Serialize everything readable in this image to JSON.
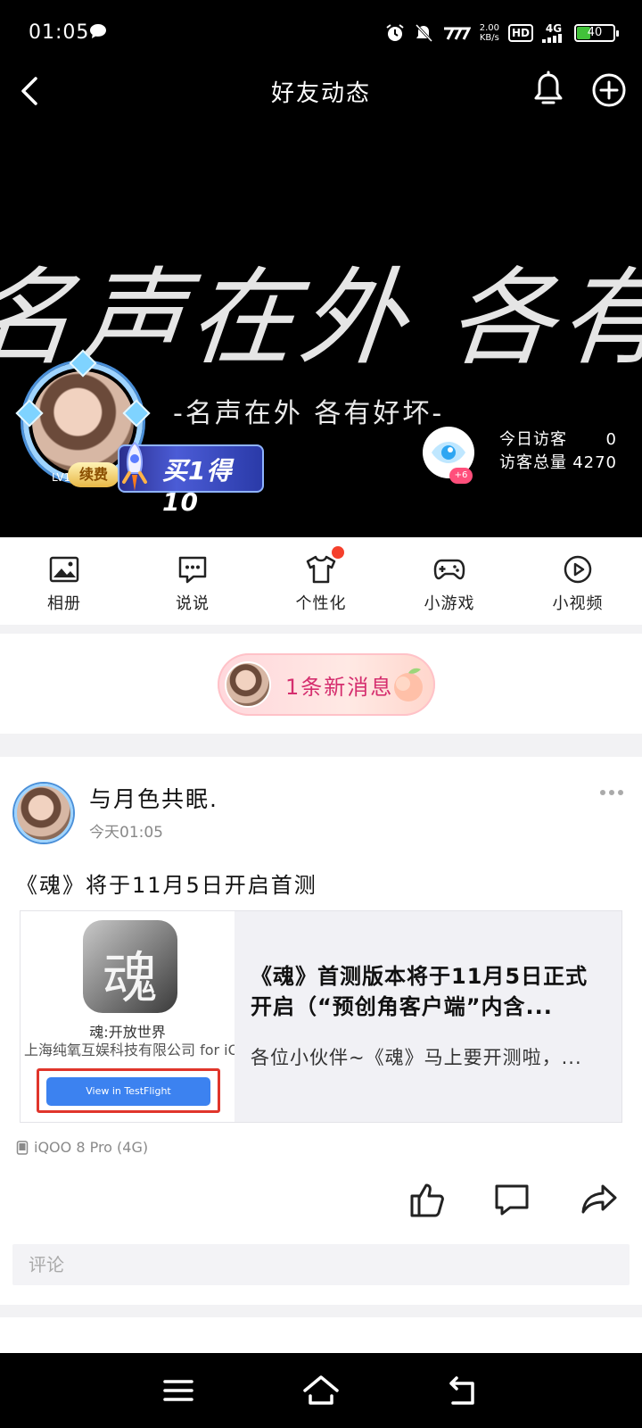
{
  "status_bar": {
    "time": "01:05",
    "net_speed_value": "2.00",
    "net_speed_unit": "KB/s",
    "hd_label": "HD",
    "network": "4G",
    "battery_level": 40,
    "battery_text": "40"
  },
  "header": {
    "title": "好友动态"
  },
  "banner": {
    "big_text": "名声在外 各有好坏",
    "sub_text": "-名声在外   各有好坏-",
    "level": "LV1",
    "renew_label": "续费",
    "promo_label": "买1得10",
    "visitor_badge": "+6",
    "today_visitors_label": "今日访客",
    "today_visitors_value": "0",
    "total_visitors_label": "访客总量",
    "total_visitors_value": "4270"
  },
  "quick_nav": {
    "items": [
      {
        "label": "相册",
        "icon": "photo-album-icon"
      },
      {
        "label": "说说",
        "icon": "speech-bubble-icon"
      },
      {
        "label": "个性化",
        "icon": "tshirt-icon",
        "has_dot": true
      },
      {
        "label": "小游戏",
        "icon": "gamepad-icon"
      },
      {
        "label": "小视频",
        "icon": "play-circle-icon"
      }
    ]
  },
  "new_message": {
    "label": "1条新消息"
  },
  "post": {
    "author": "与月色共眠.",
    "time": "今天01:05",
    "text": "《魂》将于11月5日开启首测",
    "share": {
      "thumb_icon_char": "魂",
      "thumb_title": "魂:开放世界",
      "thumb_company": "上海纯氧互娱科技有限公司 for iOS",
      "thumb_button": "View in TestFlight",
      "title": "《魂》首测版本将于11月5日正式开启（“预创角客户端”内含...",
      "desc": "各位小伙伴~《魂》马上要开测啦，..."
    },
    "device": "iQOO 8 Pro (4G)",
    "comment_placeholder": "评论"
  },
  "colors": {
    "accent_red": "#f5402c",
    "pill_text": "#d52e6e",
    "testflight_blue": "#3c82f0",
    "battery_green": "#42c23a"
  }
}
